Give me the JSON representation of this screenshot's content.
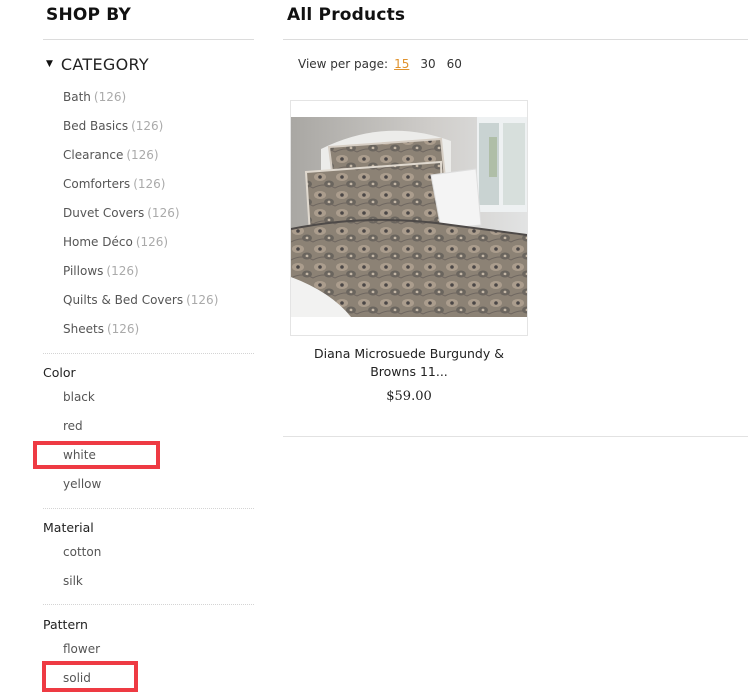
{
  "sidebar": {
    "title": "SHOP BY",
    "category": {
      "title": "CATEGORY",
      "items": [
        {
          "label": "Bath",
          "count": "(126)"
        },
        {
          "label": "Bed Basics",
          "count": "(126)"
        },
        {
          "label": "Clearance",
          "count": "(126)"
        },
        {
          "label": "Comforters",
          "count": "(126)"
        },
        {
          "label": "Duvet Covers",
          "count": "(126)"
        },
        {
          "label": "Home Déco",
          "count": "(126)"
        },
        {
          "label": "Pillows",
          "count": "(126)"
        },
        {
          "label": "Quilts & Bed Covers",
          "count": "(126)"
        },
        {
          "label": "Sheets",
          "count": "(126)"
        }
      ]
    },
    "color": {
      "title": "Color",
      "options": [
        "black",
        "red",
        "white",
        "yellow"
      ]
    },
    "material": {
      "title": "Material",
      "options": [
        "cotton",
        "silk"
      ]
    },
    "pattern": {
      "title": "Pattern",
      "options": [
        "flower",
        "solid"
      ]
    }
  },
  "main": {
    "title": "All Products",
    "view_per_page": {
      "label": "View per page:",
      "options": [
        "15",
        "30",
        "60"
      ],
      "selected": "15"
    },
    "products": [
      {
        "name_line1": "Diana Microsuede Burgundy &",
        "name_line2": "Browns 11...",
        "price": "$59.00",
        "image": "paisley-bedding-photo"
      }
    ]
  },
  "colors": {
    "highlight": "#ee3a43",
    "accent_link": "#e0922d",
    "count_gray": "#aaaaaa"
  }
}
